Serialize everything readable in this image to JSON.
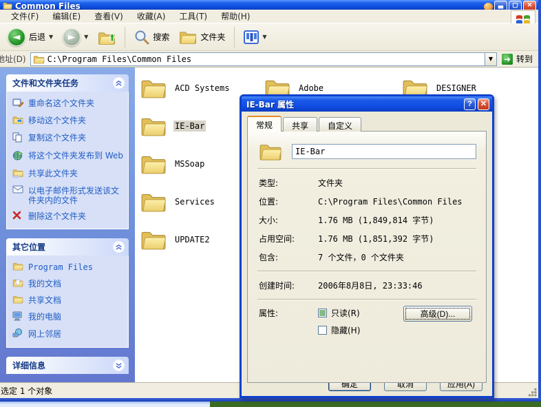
{
  "window": {
    "title": "Common Files"
  },
  "menu": {
    "items": [
      "文件(F)",
      "编辑(E)",
      "查看(V)",
      "收藏(A)",
      "工具(T)",
      "帮助(H)"
    ]
  },
  "toolbar": {
    "back_label": "后退",
    "search_label": "搜索",
    "folders_label": "文件夹"
  },
  "addressbar": {
    "label": "地址(D)",
    "value": "C:\\Program Files\\Common Files",
    "go_label": "转到"
  },
  "sidebar": {
    "tasks": {
      "title": "文件和文件夹任务",
      "items": [
        "重命名这个文件夹",
        "移动这个文件夹",
        "复制这个文件夹",
        "将这个文件夹发布到 Web",
        "共享此文件夹",
        "以电子邮件形式发送该文件夹内的文件",
        "删除这个文件夹"
      ]
    },
    "places": {
      "title": "其它位置",
      "items": [
        "Program Files",
        "我的文档",
        "共享文档",
        "我的电脑",
        "网上邻居"
      ]
    },
    "details": {
      "title": "详细信息"
    }
  },
  "content": {
    "folders": [
      "ACD Systems",
      "Adobe",
      "DESIGNER",
      "IE-Bar",
      "MSSoap",
      "Services",
      "UPDATE2"
    ],
    "selected": "IE-Bar"
  },
  "statusbar": {
    "text": "选定 1 个对象"
  },
  "dialog": {
    "title": "IE-Bar 属性",
    "tabs": [
      "常规",
      "共享",
      "自定义"
    ],
    "name_value": "IE-Bar",
    "rows": [
      {
        "label": "类型:",
        "value": "文件夹"
      },
      {
        "label": "位置:",
        "value": "C:\\Program Files\\Common Files"
      },
      {
        "label": "大小:",
        "value": "1.76 MB (1,849,814 字节)"
      },
      {
        "label": "占用空间:",
        "value": "1.76 MB (1,851,392 字节)"
      },
      {
        "label": "包含:",
        "value": "7 个文件，0 个文件夹"
      }
    ],
    "created": {
      "label": "创建时间:",
      "value": "2006年8月8日, 23:33:46"
    },
    "attributes": {
      "label": "属性:",
      "readonly": "只读(R)",
      "hidden": "隐藏(H)",
      "advanced": "高级(D)..."
    },
    "buttons": {
      "ok": "确定",
      "cancel": "取消",
      "apply": "应用(A)"
    }
  },
  "colors": {
    "titlebar_blue": "#0f4fe0",
    "taskpane_blue": "#7193dd",
    "panel_body": "#d7e0f7",
    "link_blue": "#215dc6",
    "dialog_face": "#ece9d8",
    "readonly_check_green": "#86ba86"
  }
}
